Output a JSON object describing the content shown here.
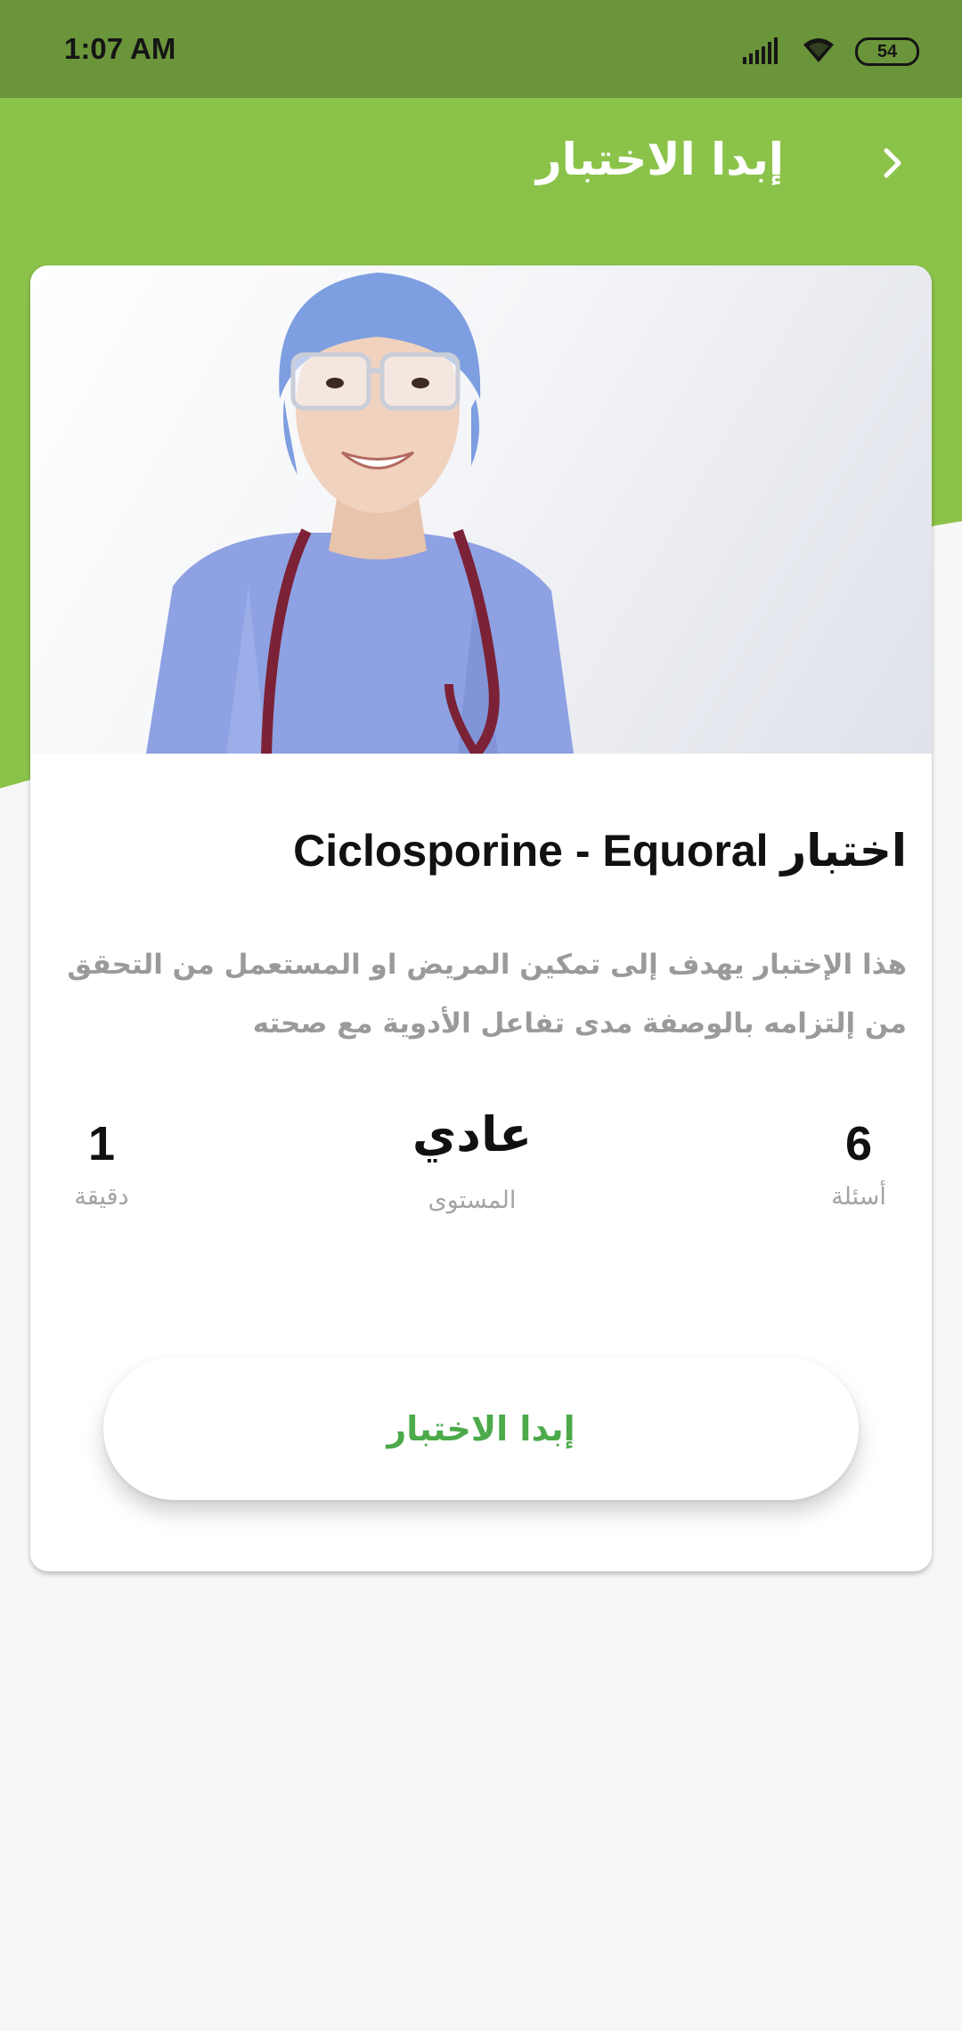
{
  "status_bar": {
    "time": "1:07 AM",
    "battery": "54",
    "icons": [
      "signal-icon",
      "wifi-icon",
      "battery-icon"
    ]
  },
  "header": {
    "title": "إبدا الاختبار",
    "back_icon": "chevron-right-icon"
  },
  "quiz": {
    "image": "nurse-photo",
    "title": "اختبار Ciclosporine - Equoral",
    "description": "هذا الإختبار يهدف إلى تمكين المريض او المستعمل من التحقق من إلتزامه بالوصفة مدى تفاعل الأدوية مع صحته",
    "stats": {
      "questions": {
        "value": "6",
        "label": "أسئلة"
      },
      "level": {
        "value": "عادي",
        "label": "المستوى"
      },
      "duration": {
        "value": "1",
        "label": "دقيقة"
      }
    },
    "start_button": "إبدا الاختبار"
  },
  "colors": {
    "header_green": "#8bc34a",
    "status_green": "#6b953a",
    "button_text": "#4caa4a",
    "background": "#f7f7f7"
  }
}
